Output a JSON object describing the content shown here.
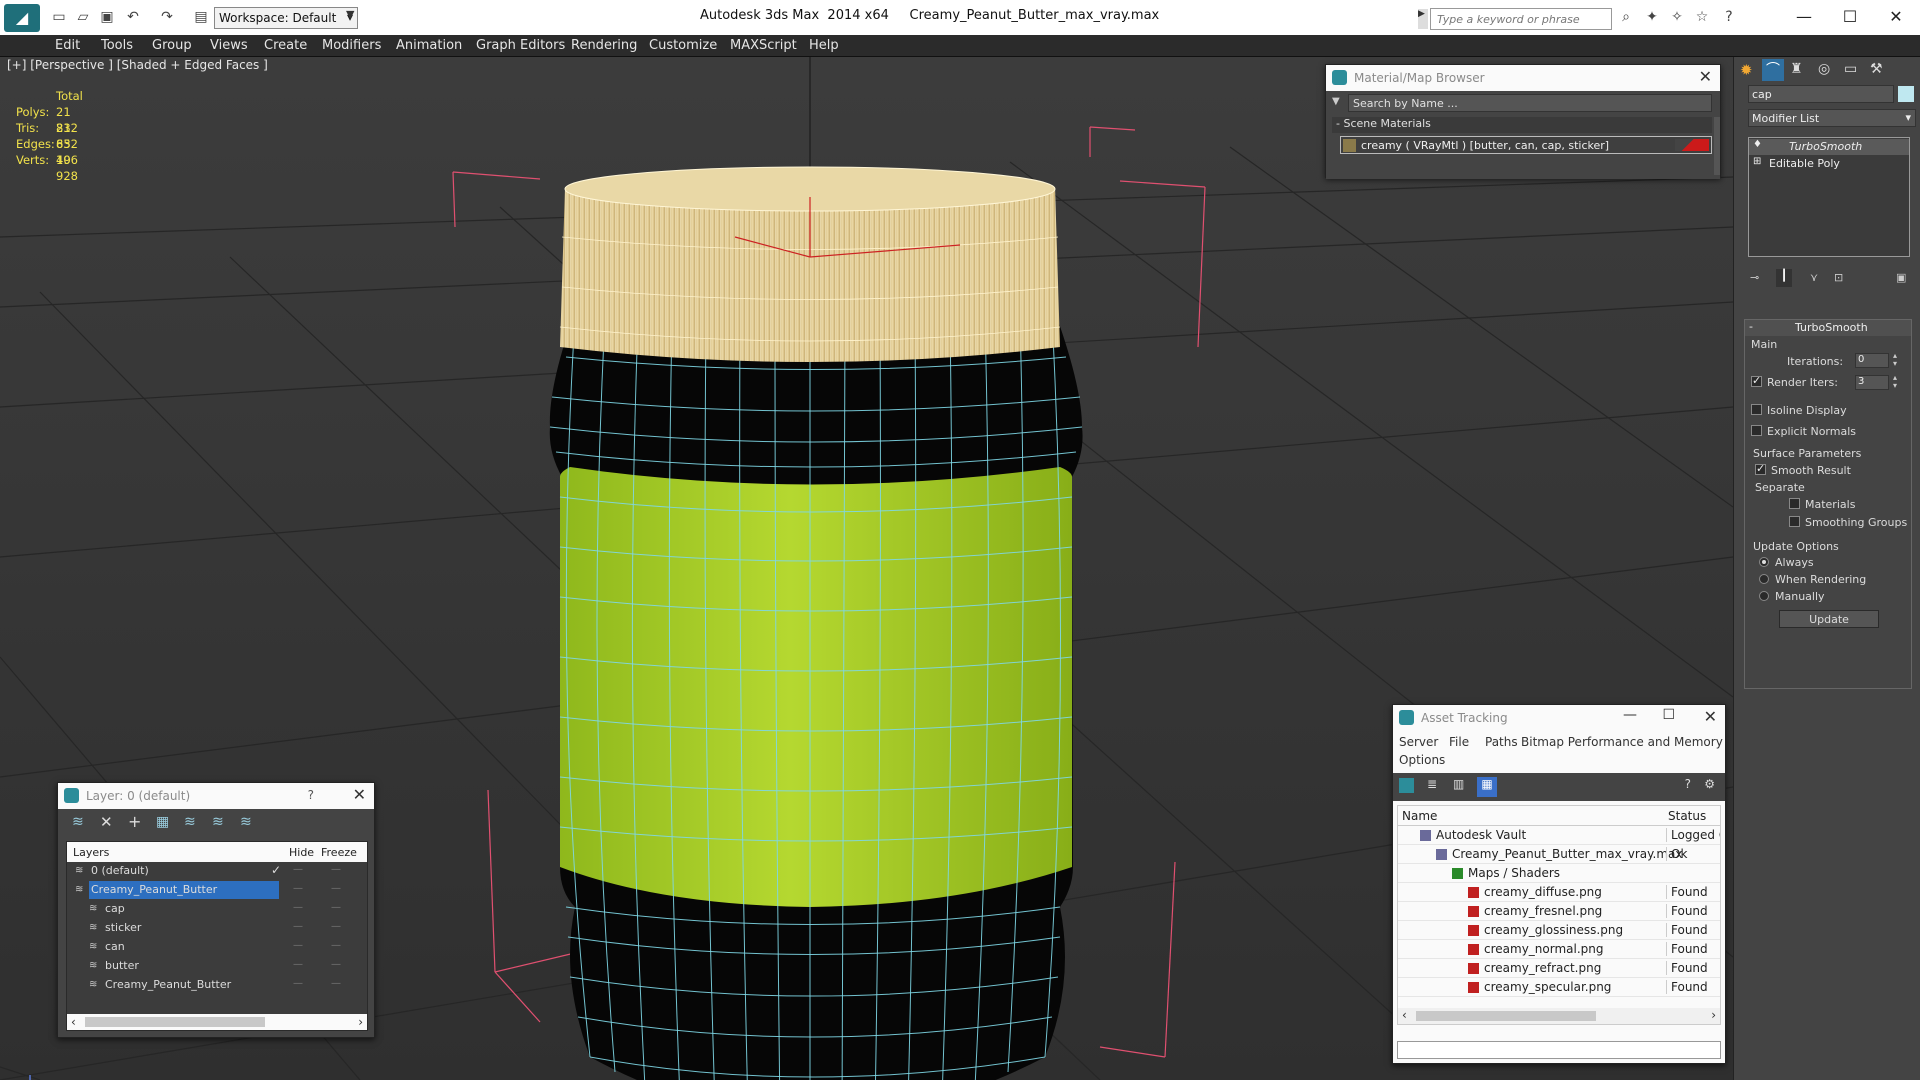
{
  "app": {
    "title": "Autodesk 3ds Max  2014 x64     Creamy_Peanut_Butter_max_vray.max",
    "workspace": "Workspace: Default",
    "search_placeholder": "Type a keyword or phrase"
  },
  "menu": [
    "Edit",
    "Tools",
    "Group",
    "Views",
    "Create",
    "Modifiers",
    "Animation",
    "Graph Editors",
    "Rendering",
    "Customize",
    "MAXScript",
    "Help"
  ],
  "viewport": {
    "label": "[+] [Perspective ] [Shaded + Edged Faces ]",
    "stats": {
      "header": "Total",
      "polys_label": "Polys:",
      "polys": "21 832",
      "tris_label": "Tris:",
      "tris": "21 832",
      "edges_label": "Edges:",
      "edges": "65 496",
      "verts_label": "Verts:",
      "verts": "10 928"
    }
  },
  "material_browser": {
    "title": "Material/Map Browser",
    "search_placeholder": "Search by Name ...",
    "section": "- Scene Materials",
    "item": "creamy  ( VRayMtl )  [butter, can, cap, sticker]",
    "swatch_color": "#cc1a1a"
  },
  "layer_window": {
    "title": "Layer: 0 (default)",
    "help": "?",
    "columns": [
      "Layers",
      "Hide",
      "Freeze"
    ],
    "rows": [
      {
        "name": "0 (default)",
        "indent": 0
      },
      {
        "name": "Creamy_Peanut_Butter",
        "indent": 0,
        "selected": true
      },
      {
        "name": "cap",
        "indent": 1
      },
      {
        "name": "sticker",
        "indent": 1
      },
      {
        "name": "can",
        "indent": 1
      },
      {
        "name": "butter",
        "indent": 1
      },
      {
        "name": "Creamy_Peanut_Butter",
        "indent": 1
      }
    ]
  },
  "asset_tracking": {
    "title": "Asset Tracking",
    "menu": [
      "Server",
      "File",
      "Paths",
      "Bitmap Performance and Memory",
      "Options"
    ],
    "columns": [
      "Name",
      "Status"
    ],
    "rows": [
      {
        "name": "Autodesk Vault",
        "status": "Logged O",
        "indent": 1
      },
      {
        "name": "Creamy_Peanut_Butter_max_vray.max",
        "status": "Ok",
        "indent": 2
      },
      {
        "name": "Maps / Shaders",
        "status": "",
        "indent": 3
      },
      {
        "name": "creamy_diffuse.png",
        "status": "Found",
        "indent": 4
      },
      {
        "name": "creamy_fresnel.png",
        "status": "Found",
        "indent": 4
      },
      {
        "name": "creamy_glossiness.png",
        "status": "Found",
        "indent": 4
      },
      {
        "name": "creamy_normal.png",
        "status": "Found",
        "indent": 4
      },
      {
        "name": "creamy_refract.png",
        "status": "Found",
        "indent": 4
      },
      {
        "name": "creamy_specular.png",
        "status": "Found",
        "indent": 4
      }
    ]
  },
  "command_panel": {
    "object_name": "cap",
    "modifier_list": "Modifier List",
    "stack": [
      "TurboSmooth",
      "Editable Poly"
    ],
    "rollout_title": "TurboSmooth",
    "main_label": "Main",
    "iterations_label": "Iterations:",
    "iterations": "0",
    "render_iters_label": "Render Iters:",
    "render_iters": "3",
    "isoline_label": "Isoline Display",
    "explicit_normals_label": "Explicit Normals",
    "surface_params_label": "Surface Parameters",
    "smooth_result_label": "Smooth Result",
    "separate_label": "Separate",
    "materials_label": "Materials",
    "smoothing_groups_label": "Smoothing Groups",
    "update_options_label": "Update Options",
    "always_label": "Always",
    "when_rendering_label": "When Rendering",
    "manually_label": "Manually",
    "update_button": "Update"
  }
}
